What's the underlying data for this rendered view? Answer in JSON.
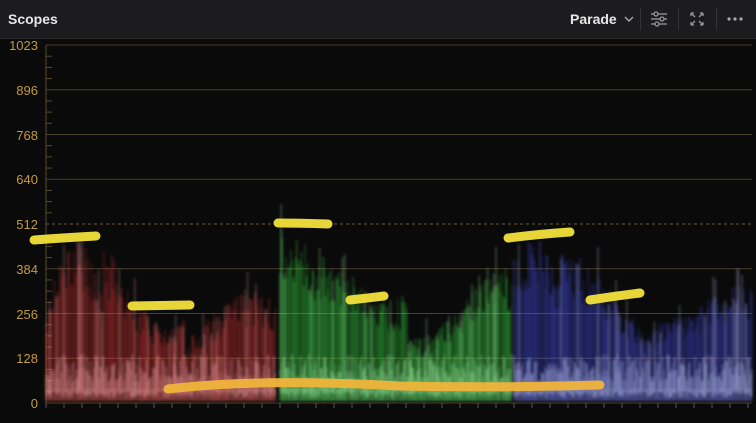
{
  "header": {
    "title": "Scopes",
    "mode_label": "Parade"
  },
  "icons": {
    "dropdown": "chevron-down-icon",
    "settings": "sliders-icon",
    "expand": "expand-icon",
    "more": "more-options-icon"
  },
  "scope": {
    "type": "RGB parade",
    "y_axis_ticks": [
      "1023",
      "896",
      "768",
      "640",
      "512",
      "384",
      "256",
      "128",
      "0"
    ],
    "colors": {
      "red": "#ff3b3b",
      "green": "#3dff4a",
      "blue": "#4a55ff",
      "annotation": "#f2e23a",
      "annotation_orange": "#f0b43a",
      "axis_label": "#c49a3a"
    }
  }
}
